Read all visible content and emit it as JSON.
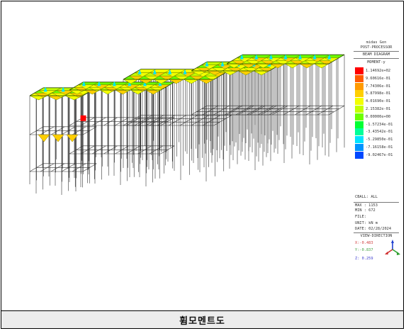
{
  "header": {
    "software": "midas Gen",
    "mode": "POST-PROCESSOR",
    "diagram": "BEAM DIAGRAM",
    "component": "MOMENT-y"
  },
  "legend": {
    "entries": [
      {
        "value": "1.14692e+02",
        "color": "#ff0000"
      },
      {
        "value": "9.60616e-01",
        "color": "#ff5a00"
      },
      {
        "value": "7.74306e-01",
        "color": "#ff9a00"
      },
      {
        "value": "5.87998e-01",
        "color": "#ffcf00"
      },
      {
        "value": "4.01690e-01",
        "color": "#f3ff00"
      },
      {
        "value": "2.15382e-01",
        "color": "#c4ff00"
      },
      {
        "value": "0.00000e+00",
        "color": "#6cff00"
      },
      {
        "value": "-1.57234e-01",
        "color": "#00ff33"
      },
      {
        "value": "-3.43542e-01",
        "color": "#00ff99"
      },
      {
        "value": "-5.29850e-01",
        "color": "#00e4ff"
      },
      {
        "value": "-7.16158e-01",
        "color": "#0094ff"
      },
      {
        "value": "-9.02467e-01",
        "color": "#0048ff"
      }
    ]
  },
  "info": {
    "load_case": "CBALL: ALL",
    "max": "MAX : 1153",
    "min": "MIN : 672",
    "file": "FILE:",
    "unit": "UNIT: kN m",
    "date": "DATE: 02/28/2024",
    "view_title": "VIEW-DIRECTION",
    "view_x": "X:-0.483",
    "view_y": "Y:-0.837",
    "view_z": "Z: 0.259"
  },
  "caption": "휨모멘트도",
  "colors": {
    "view_x": "#d04040",
    "view_y": "#40a040",
    "view_z": "#4040d0"
  }
}
